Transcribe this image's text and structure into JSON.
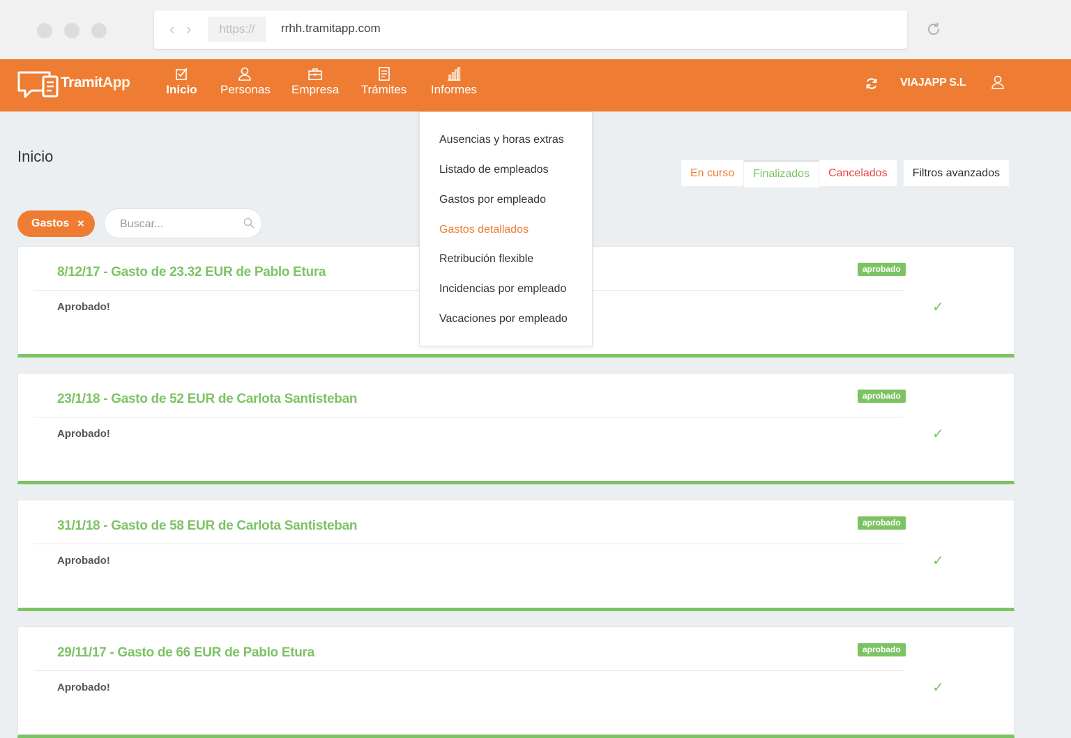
{
  "browser": {
    "protocol": "https://",
    "url": "rrhh.tramitapp.com"
  },
  "brand": {
    "name_part1": "Tramit",
    "name_part2": "App"
  },
  "nav": {
    "items": [
      {
        "label": "Inicio",
        "icon": "checkbox-icon"
      },
      {
        "label": "Personas",
        "icon": "person-icon"
      },
      {
        "label": "Empresa",
        "icon": "briefcase-icon"
      },
      {
        "label": "Trámites",
        "icon": "document-icon"
      },
      {
        "label": "Informes",
        "icon": "bar-chart-icon"
      }
    ],
    "active": "Inicio",
    "company": "VIAJAPP S.L"
  },
  "page": {
    "title": "Inicio"
  },
  "tabs": {
    "en_curso": "En curso",
    "finalizados": "Finalizados",
    "cancelados": "Cancelados",
    "filtros": "Filtros avanzados"
  },
  "filter_chip": {
    "label": "Gastos",
    "remove": "×"
  },
  "search": {
    "placeholder": "Buscar...",
    "value": ""
  },
  "dropdown": {
    "items": [
      "Ausencias y horas extras",
      "Listado de empleados",
      "Gastos por empleado",
      "Gastos detallados",
      "Retribución flexible",
      "Incidencias por empleado",
      "Vacaciones por empleado"
    ],
    "active_item": "Gastos detallados"
  },
  "cards": [
    {
      "title": "8/12/17 - Gasto de 23.32 EUR de Pablo Etura",
      "status": "Aprobado!",
      "badge": "aprobado",
      "check": "✓"
    },
    {
      "title": "23/1/18 - Gasto de 52 EUR de Carlota Santisteban",
      "status": "Aprobado!",
      "badge": "aprobado",
      "check": "✓"
    },
    {
      "title": "31/1/18 - Gasto de 58 EUR de Carlota Santisteban",
      "status": "Aprobado!",
      "badge": "aprobado",
      "check": "✓"
    },
    {
      "title": "29/11/17 - Gasto de 66 EUR de Pablo Etura",
      "status": "Aprobado!",
      "badge": "aprobado",
      "check": "✓"
    }
  ],
  "colors": {
    "brand_orange": "#ee7d33",
    "approved_green": "#7cc364",
    "cancelled_red": "#e84545"
  }
}
